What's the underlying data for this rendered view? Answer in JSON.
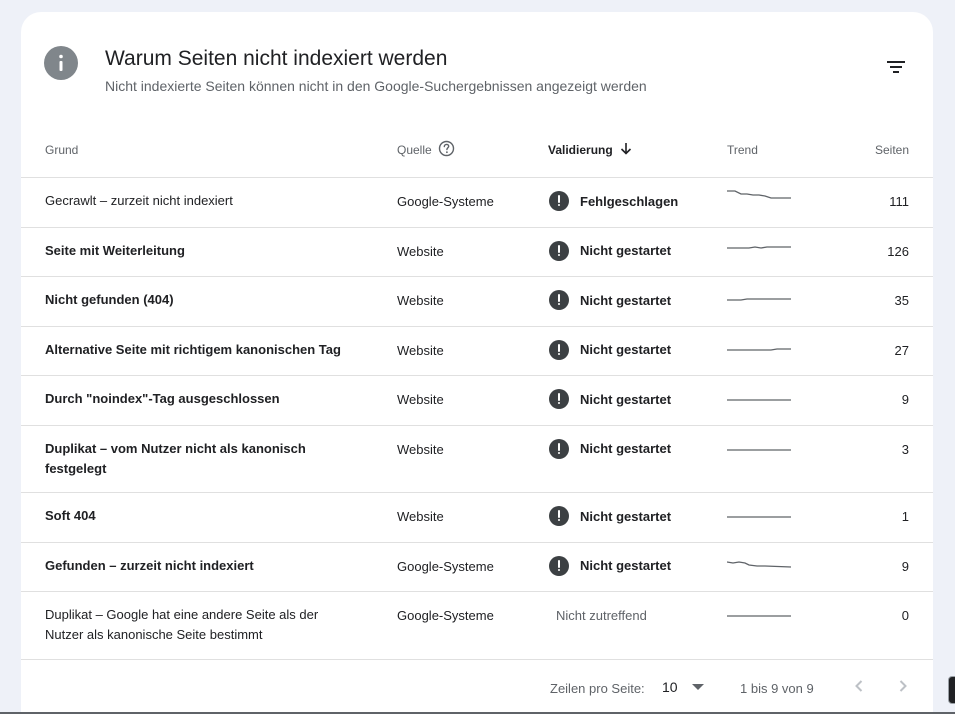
{
  "header": {
    "icon": "info-icon",
    "title": "Warum Seiten nicht indexiert werden",
    "subtitle": "Nicht indexierte Seiten können nicht in den Google-Suchergebnissen angezeigt werden",
    "filter_icon": "filter-icon"
  },
  "columns": {
    "grund": "Grund",
    "quelle": "Quelle",
    "validierung": "Validierung",
    "trend": "Trend",
    "seiten": "Seiten"
  },
  "rows": [
    {
      "grund": "Gecrawlt – zurzeit nicht indexiert",
      "quelle": "Google-Systeme",
      "validierung": "Fehlgeschlagen",
      "seiten": "111"
    },
    {
      "grund": "Seite mit Weiterleitung",
      "quelle": "Website",
      "validierung": "Nicht gestartet",
      "seiten": "126"
    },
    {
      "grund": "Nicht gefunden (404)",
      "quelle": "Website",
      "validierung": "Nicht gestartet",
      "seiten": "35"
    },
    {
      "grund": "Alternative Seite mit richtigem kanonischen Tag",
      "quelle": "Website",
      "validierung": "Nicht gestartet",
      "seiten": "27"
    },
    {
      "grund": "Durch \"noindex\"-Tag ausgeschlossen",
      "quelle": "Website",
      "validierung": "Nicht gestartet",
      "seiten": "9"
    },
    {
      "grund": "Duplikat – vom Nutzer nicht als kanonisch festgelegt",
      "quelle": "Website",
      "validierung": "Nicht gestartet",
      "seiten": "3"
    },
    {
      "grund": "Soft 404",
      "quelle": "Website",
      "validierung": "Nicht gestartet",
      "seiten": "1"
    },
    {
      "grund": "Gefunden – zurzeit nicht indexiert",
      "quelle": "Google-Systeme",
      "validierung": "Nicht gestartet",
      "seiten": "9"
    },
    {
      "grund": "Duplikat – Google hat eine andere Seite als der Nutzer als kanonische Seite bestimmt",
      "quelle": "Google-Systeme",
      "validierung": "Nicht zutreffend",
      "seiten": "0"
    }
  ],
  "footer": {
    "rows_label": "Zeilen pro Seite:",
    "rows_value": "10",
    "range": "1 bis 9 von 9"
  }
}
